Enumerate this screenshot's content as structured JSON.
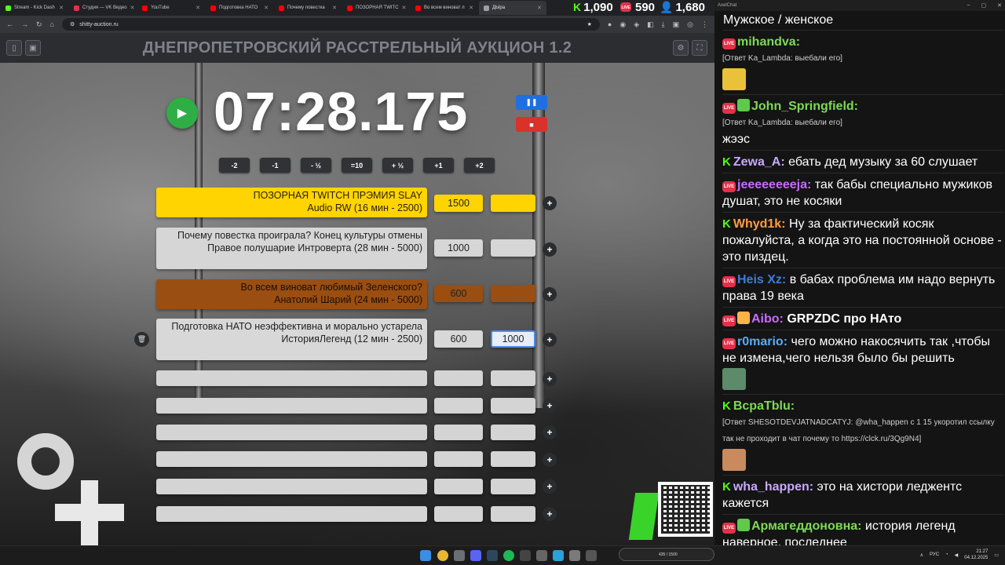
{
  "browser": {
    "tabs": [
      {
        "label": "Stream - Kick Dash",
        "color": "#53fc18"
      },
      {
        "label": "Студия — VK Видео",
        "color": "#e5304a"
      },
      {
        "label": "YouTube",
        "color": "#ff0000"
      },
      {
        "label": "Подготовка НАТО",
        "color": "#ff0000"
      },
      {
        "label": "Почему повестка",
        "color": "#ff0000"
      },
      {
        "label": "ПОЗОРНАЯ TWITC",
        "color": "#ff0000"
      },
      {
        "label": "Во всем виноват л",
        "color": "#ff0000"
      },
      {
        "label": "ДЫра",
        "color": "#9aa0a6"
      }
    ],
    "url": "shitty-auction.ru"
  },
  "stats": {
    "kick_count": "1,090",
    "vk_count": "590",
    "viewers_count": "1,680"
  },
  "app": {
    "title": "ДНЕПРОПЕТРОВСКИЙ РАССТРЕЛЬНЫЙ АУКЦИОН 1.2",
    "timer": "07:28.175",
    "adjust_buttons": [
      "-2",
      "-1",
      "- ½",
      "=10",
      "+ ½",
      "+1",
      "+2"
    ]
  },
  "lots": [
    {
      "title": "ПОЗОРНАЯ TWITCH ПРЭМИЯ SLAY",
      "subtitle": "Audio RW (16 мин - 2500)",
      "amount": "1500",
      "extra": "",
      "color": "#ffd400",
      "text_color": "#2a2200"
    },
    {
      "title": "Почему повестка проиграла? Конец культуры отмены",
      "subtitle": "Правое полушарие Интроверта (28 мин - 5000)",
      "amount": "1000",
      "extra": "",
      "color": "#d6d6d6",
      "text_color": "#222222"
    },
    {
      "title": "Во всем виноват любимый Зеленского?",
      "subtitle": "Анатолий Шарий (24 мин - 5000)",
      "amount": "600",
      "extra": "",
      "color": "#9a4e12",
      "text_color": "#1c0e02"
    },
    {
      "title": "Подготовка НАТО неэффективна и морально устарела",
      "subtitle": "ИсторияЛегенд (12 мин - 2500)",
      "amount": "600",
      "extra": "1000",
      "color": "#d8d8d8",
      "text_color": "#222222"
    }
  ],
  "chat": {
    "window_title": "AxelChat",
    "header": "Мужское / женское",
    "messages": [
      {
        "platform": "vk",
        "name": "mihandva:",
        "name_color": "#7ed957",
        "reply": "[Ответ Ka_Lambda: выебали его]",
        "text": "",
        "emote": "#e9c23a"
      },
      {
        "platform": "vk",
        "badge": "#5fc94a",
        "name": "John_Springfield:",
        "name_color": "#7ed957",
        "reply": "[Ответ Ka_Lambda: выебали его]",
        "text": "жээс"
      },
      {
        "platform": "kick",
        "name": "Zewa_A:",
        "name_color": "#c9a8ff",
        "text": "ебать дед музыку за 60 слушает"
      },
      {
        "platform": "vk",
        "name": "jeeeeeeeeja:",
        "name_color": "#c86bff",
        "text": "так бабы специально мужиков душат, это не косяки"
      },
      {
        "platform": "kick",
        "name": "Whyd1k:",
        "name_color": "#ff9e3d",
        "text": "Ну за фактический косяк пожалуйста, а когда это на постоянной основе - это пиздец."
      },
      {
        "platform": "vk",
        "name": "Heis Xz:",
        "name_color": "#3f7bd9",
        "text": "в бабах проблема им надо вернуть права 19 века"
      },
      {
        "platform": "vk",
        "badge": "#ffb347",
        "name": "Aibo:",
        "name_color": "#c86bff",
        "text": "GRPZDC про НАто",
        "text_bold": true
      },
      {
        "platform": "vk",
        "name": "r0mario:",
        "name_color": "#5aaaf2",
        "text": "чего можно накосячить так ,чтобы не измена,чего нельзя было бы решить",
        "emote": "#5d8a6a"
      },
      {
        "platform": "kick",
        "name": "BcpaTblu:",
        "name_color": "#7ed957",
        "reply": "[Ответ SHESOTDEVJATNADCATYJ: @wha_happen с 1 15 укоротил ссылку так не проходит в чат почему то https://clck.ru/3Qg9N4]",
        "text": "",
        "emote": "#c98a5e"
      },
      {
        "platform": "kick",
        "name": "wha_happen:",
        "name_color": "#c9a8ff",
        "text": "это на хистори леджентс кажется"
      },
      {
        "platform": "vk",
        "badge": "#5fc94a",
        "name": "Армагеддоновна:",
        "name_color": "#7ed957",
        "text": "история легенд наверное, последнее"
      }
    ]
  },
  "taskbar": {
    "lang": "РУС",
    "time": "21:27",
    "date": "04.12.2025",
    "stream_counter": "435 / 1500"
  }
}
